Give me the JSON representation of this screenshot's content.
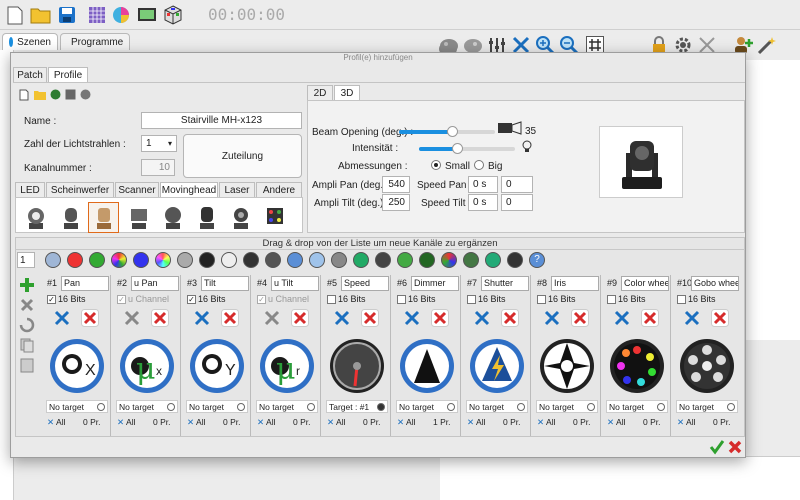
{
  "toolbar": {
    "timer": "00:00:00",
    "left_icons": [
      "new-doc-icon",
      "open-folder-icon",
      "save-disk-icon",
      "grid-icon",
      "palette-icon",
      "screen-icon",
      "cube-icon"
    ],
    "right_icons": [
      "blob-icon",
      "blob2-icon",
      "sliders-icon",
      "tools-icon",
      "zoom-in-icon",
      "zoom-out-icon",
      "hash-icon",
      "lock-icon",
      "settings-icon",
      "scissors-icon",
      "person-add-icon",
      "wand-icon"
    ]
  },
  "main_tabs": [
    {
      "label": "Szenen",
      "color": "#1a8fe0"
    },
    {
      "label": "Programme",
      "color": "#2ea02e"
    }
  ],
  "dialog": {
    "title": "Profil(e) hinzufügen",
    "tabs": [
      "Patch",
      "Profile"
    ],
    "name_label": "Name :",
    "name_value": "Stairville MH-x123",
    "beams_label": "Zahl der Lichtstrahlen :",
    "beams_value": "1",
    "channel_label": "Kanalnummer :",
    "channel_value": "10",
    "split_button": "Zuteilung",
    "category_tabs": [
      "LED",
      "Scheinwerfer",
      "Scanner",
      "Movinghead",
      "Laser",
      "Andere"
    ],
    "active_category": "Movinghead",
    "view_tabs": [
      "2D",
      "3D"
    ],
    "beam_label": "Beam Opening (deg.) :",
    "beam_value": "35",
    "intensity_label": "Intensität :",
    "dims_label": "Abmessungen :",
    "small": "Small",
    "big": "Big",
    "pan_label": "Ampli Pan (deg.) :",
    "pan_value": "540",
    "pan_speed_label": "Speed Pan :",
    "pan_speed_value": "0 s",
    "pan_speed_value2": "0",
    "tilt_label": "Ampli Tilt (deg.) :",
    "tilt_value": "250",
    "tilt_speed_label": "Speed Tilt :",
    "tilt_speed_value": "0 s",
    "tilt_speed_value2": "0",
    "dnd_hint": "Drag & drop von der Liste um neue Kanäle zu ergänzen",
    "channel_count": "1",
    "bits_label": "16 Bits",
    "uchannel_label": "u Channel",
    "channels": [
      {
        "num": "#1",
        "name": "Pan",
        "bits": "16 Bits",
        "checked": true,
        "dim": false,
        "target": "No target",
        "all": "All",
        "pr": "0 Pr."
      },
      {
        "num": "#2",
        "name": "u Pan",
        "bits": "u Channel",
        "checked": true,
        "dim": true,
        "target": "No target",
        "all": "All",
        "pr": "0 Pr."
      },
      {
        "num": "#3",
        "name": "Tilt",
        "bits": "16 Bits",
        "checked": true,
        "dim": false,
        "target": "No target",
        "all": "All",
        "pr": "0 Pr."
      },
      {
        "num": "#4",
        "name": "u Tilt",
        "bits": "u Channel",
        "checked": true,
        "dim": true,
        "target": "No target",
        "all": "All",
        "pr": "0 Pr."
      },
      {
        "num": "#5",
        "name": "Speed",
        "bits": "16 Bits",
        "checked": false,
        "dim": false,
        "target": "Target : #1",
        "all": "All",
        "pr": "0 Pr."
      },
      {
        "num": "#6",
        "name": "Dimmer",
        "bits": "16 Bits",
        "checked": false,
        "dim": false,
        "target": "No target",
        "all": "All",
        "pr": "1 Pr."
      },
      {
        "num": "#7",
        "name": "Shutter",
        "bits": "16 Bits",
        "checked": false,
        "dim": false,
        "target": "No target",
        "all": "All",
        "pr": "0 Pr."
      },
      {
        "num": "#8",
        "name": "Iris",
        "bits": "16 Bits",
        "checked": false,
        "dim": false,
        "target": "No target",
        "all": "All",
        "pr": "0 Pr."
      },
      {
        "num": "#9",
        "name": "Color wheel",
        "bits": "16 Bits",
        "checked": false,
        "dim": false,
        "target": "No target",
        "all": "All",
        "pr": "0 Pr."
      },
      {
        "num": "#10",
        "name": "Gobo wheel",
        "bits": "16 Bits",
        "checked": false,
        "dim": false,
        "target": "No target",
        "all": "All",
        "pr": "0 Pr."
      }
    ],
    "channel_icons": [
      "pan-x-icon",
      "micro-pan-icon",
      "tilt-y-icon",
      "micro-tilt-icon",
      "speed-gauge-icon",
      "dimmer-triangle-icon",
      "shutter-icon",
      "iris-icon",
      "color-wheel-icon",
      "gobo-wheel-icon"
    ],
    "colors": {
      "accent": "#1a8fe0",
      "ok": "#2ea02e",
      "cancel": "#d62b2b"
    }
  }
}
